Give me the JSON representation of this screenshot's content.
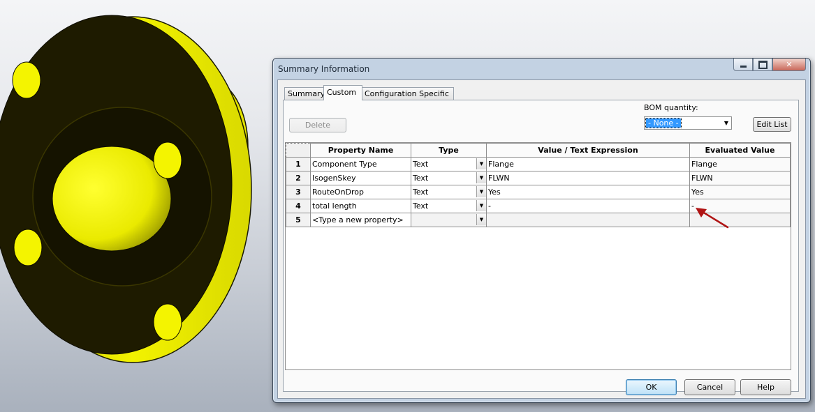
{
  "dialog": {
    "title": "Summary Information",
    "tabs": [
      {
        "label": "Summary",
        "active": false
      },
      {
        "label": "Custom",
        "active": true
      },
      {
        "label": "Configuration Specific",
        "active": false
      }
    ],
    "delete_label": "Delete",
    "bom_label": "BOM quantity:",
    "bom_value": "- None -",
    "edit_list_label": "Edit List",
    "columns": [
      "Property Name",
      "Type",
      "Value / Text Expression",
      "Evaluated Value"
    ],
    "rows": [
      {
        "num": "1",
        "name": "Component Type",
        "type": "Text",
        "value": "Flange",
        "evaluated": "Flange"
      },
      {
        "num": "2",
        "name": "IsogenSkey",
        "type": "Text",
        "value": "FLWN",
        "evaluated": "FLWN"
      },
      {
        "num": "3",
        "name": "RouteOnDrop",
        "type": "Text",
        "value": "Yes",
        "evaluated": "Yes"
      },
      {
        "num": "4",
        "name": "total length",
        "type": "Text",
        "value": "-",
        "evaluated": "-"
      },
      {
        "num": "5",
        "name": "<Type a new property>",
        "type": "",
        "value": "",
        "evaluated": ""
      }
    ],
    "ok_label": "OK",
    "cancel_label": "Cancel",
    "help_label": "Help"
  },
  "colors": {
    "flange_yellow": "#f2f200",
    "flange_dark": "#1d1a00",
    "annotation_arrow": "#b01414",
    "selection_blue": "#3399ff"
  },
  "icons": [
    "minimize-icon",
    "maximize-icon",
    "close-icon",
    "dropdown-arrow-icon",
    "annotation-arrow"
  ]
}
